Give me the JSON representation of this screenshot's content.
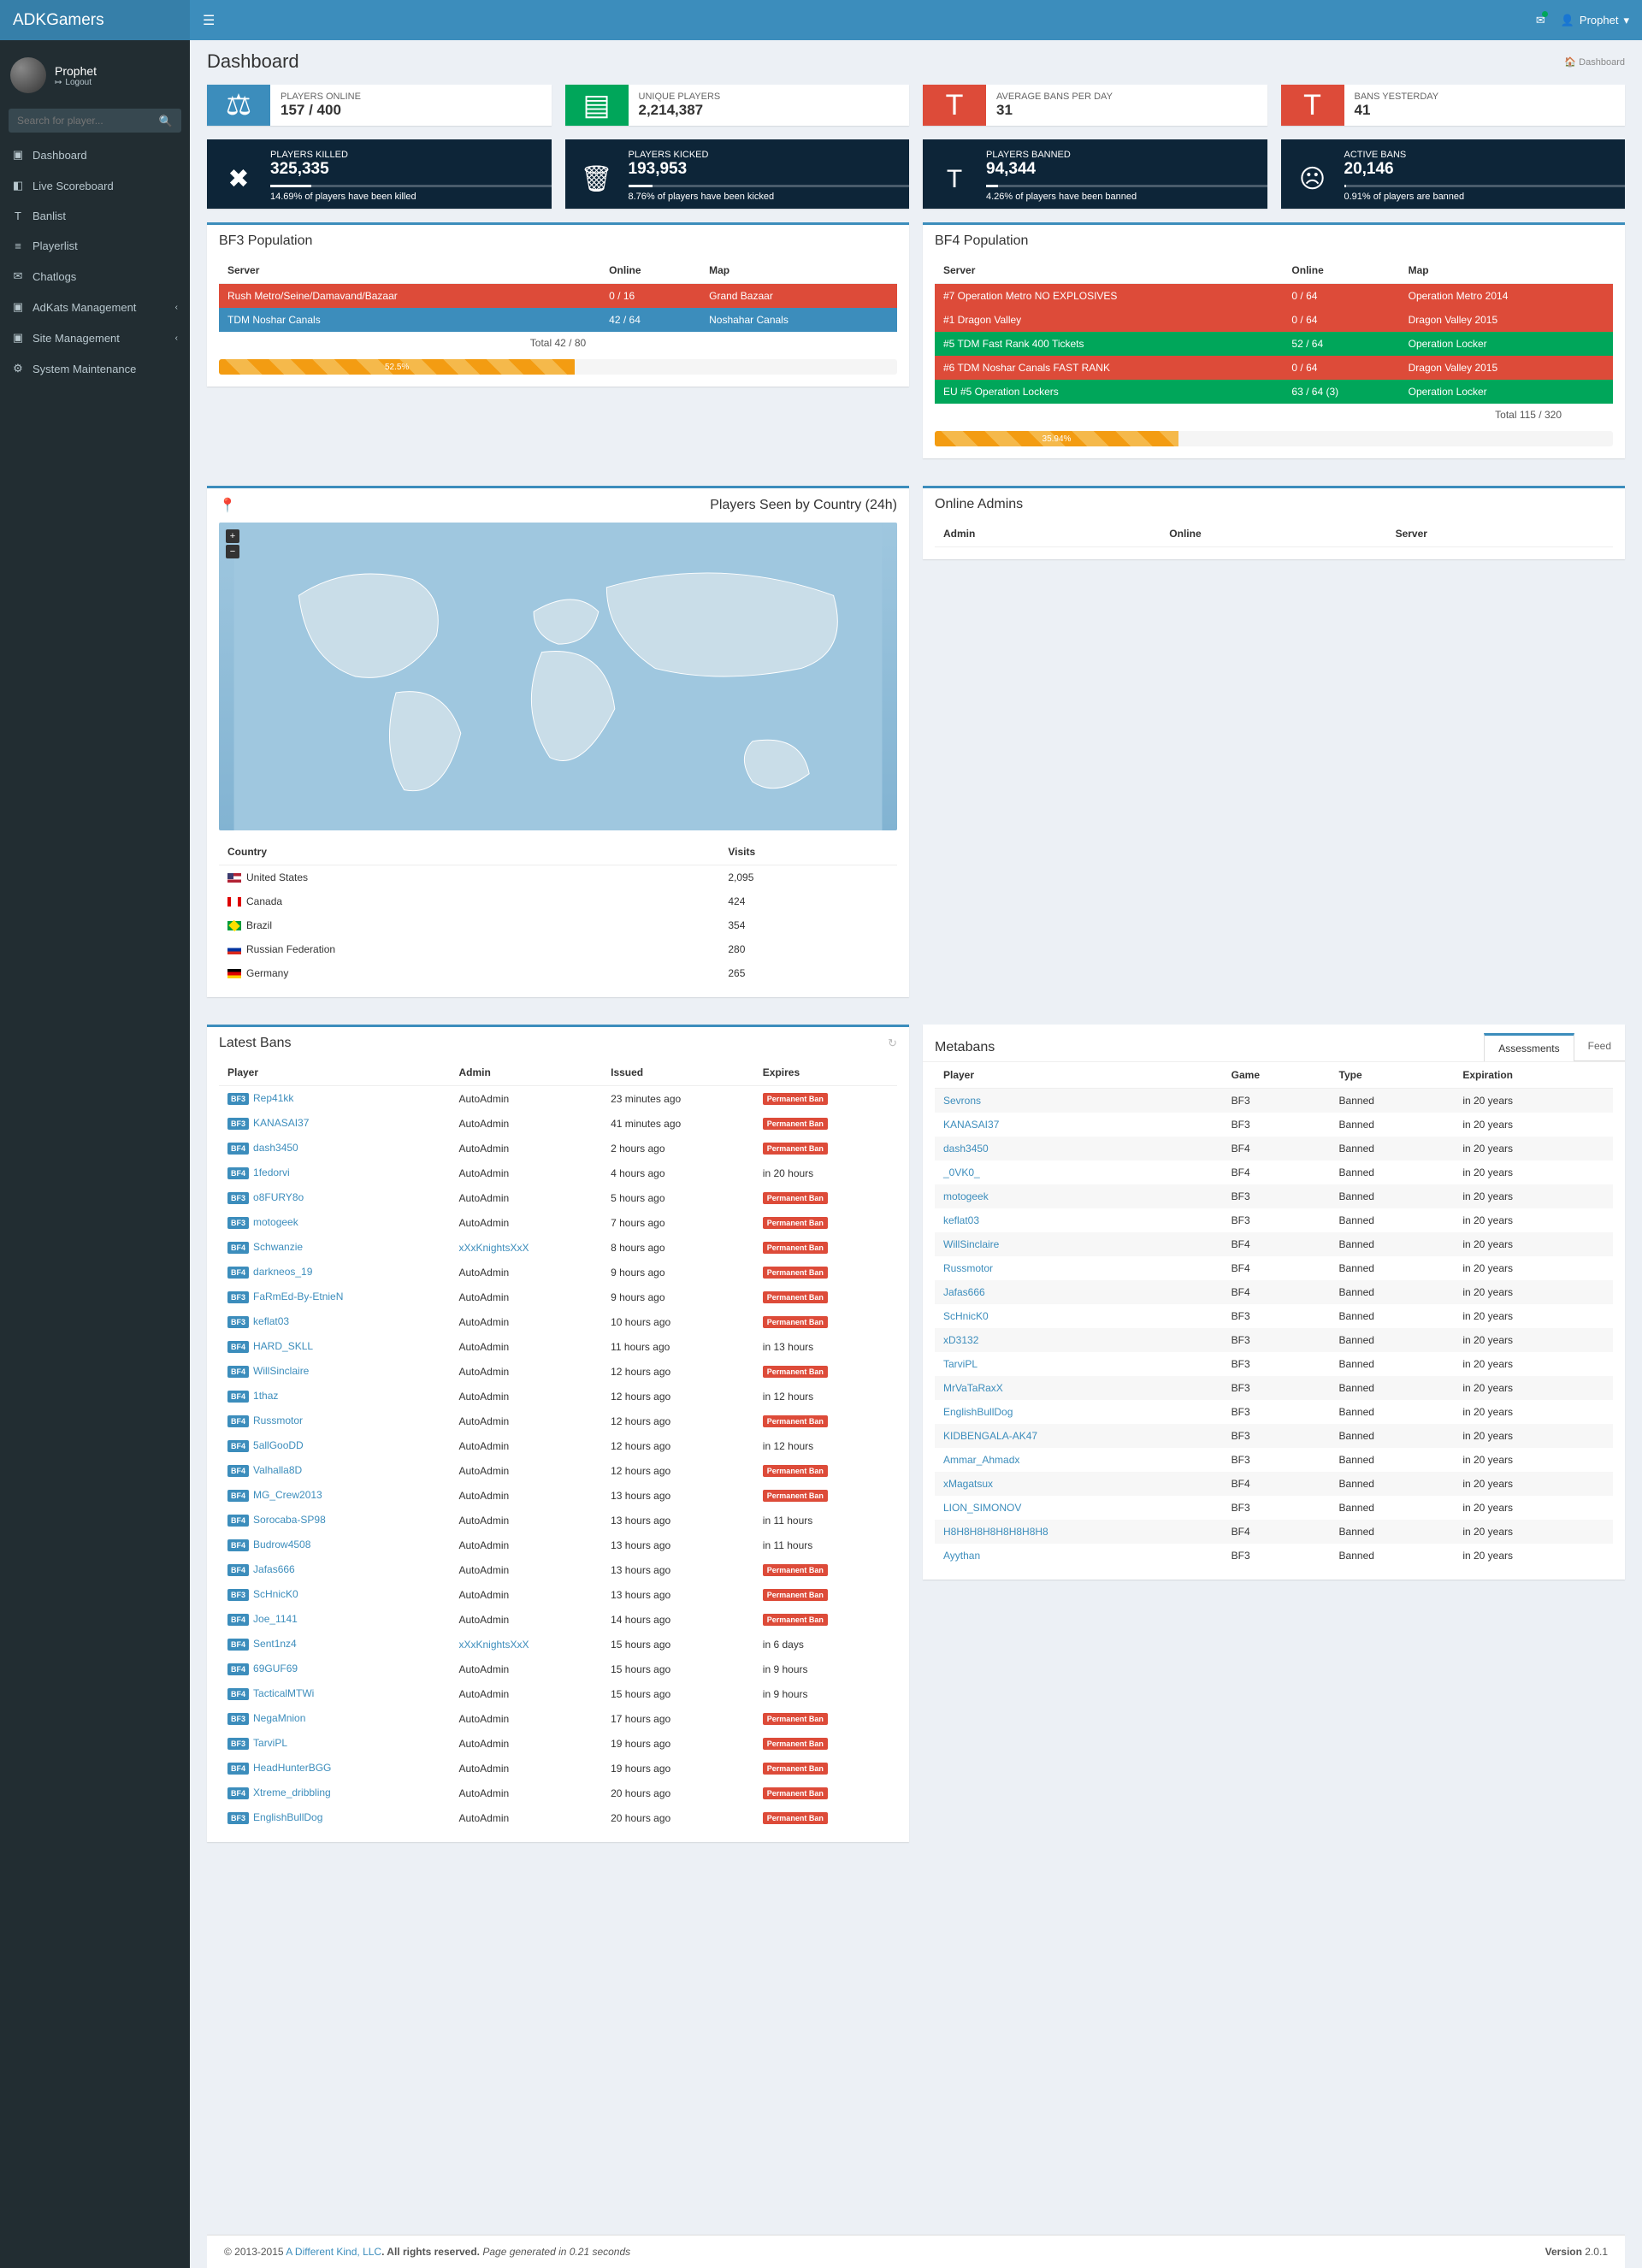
{
  "brand": "ADKGamers",
  "user": {
    "name": "Prophet",
    "logout": "Logout"
  },
  "search": {
    "placeholder": "Search for player..."
  },
  "nav": [
    {
      "icon": "▣",
      "label": "Dashboard"
    },
    {
      "icon": "◧",
      "label": "Live Scoreboard"
    },
    {
      "icon": "T",
      "label": "Banlist"
    },
    {
      "icon": "≡",
      "label": "Playerlist"
    },
    {
      "icon": "✉",
      "label": "Chatlogs"
    },
    {
      "icon": "▣",
      "label": "AdKats Management",
      "sub": true
    },
    {
      "icon": "▣",
      "label": "Site Management",
      "sub": true
    },
    {
      "icon": "⚙",
      "label": "System Maintenance"
    }
  ],
  "page_title": "Dashboard",
  "breadcrumb": "Dashboard",
  "stats_top": [
    {
      "label": "PLAYERS ONLINE",
      "value": "157 / 400",
      "color": "#3c8dbc",
      "icon": "⚖"
    },
    {
      "label": "UNIQUE PLAYERS",
      "value": "2,214,387",
      "color": "#00a65a",
      "icon": "▤"
    },
    {
      "label": "AVERAGE BANS PER DAY",
      "value": "31",
      "color": "#dd4b39",
      "icon": "T"
    },
    {
      "label": "BANS YESTERDAY",
      "value": "41",
      "color": "#dd4b39",
      "icon": "T"
    }
  ],
  "kpis": [
    {
      "label": "PLAYERS KILLED",
      "value": "325,335",
      "desc": "14.69% of players have been killed",
      "pct": 14.69,
      "icon": "✖"
    },
    {
      "label": "PLAYERS KICKED",
      "value": "193,953",
      "desc": "8.76% of players have been kicked",
      "pct": 8.76,
      "icon": "🗑"
    },
    {
      "label": "PLAYERS BANNED",
      "value": "94,344",
      "desc": "4.26% of players have been banned",
      "pct": 4.26,
      "icon": "T"
    },
    {
      "label": "ACTIVE BANS",
      "value": "20,146",
      "desc": "0.91% of players are banned",
      "pct": 0.91,
      "icon": "☹"
    }
  ],
  "bf3": {
    "title": "BF3 Population",
    "cols": [
      "Server",
      "Online",
      "Map"
    ],
    "rows": [
      {
        "cls": "srv-red",
        "server": "Rush Metro/Seine/Damavand/Bazaar",
        "online": "0 / 16",
        "map": "Grand Bazaar"
      },
      {
        "cls": "srv-blue",
        "server": "TDM Noshar Canals",
        "online": "42 / 64",
        "map": "Noshahar Canals"
      }
    ],
    "total": "Total   42 / 80",
    "progress": "52.5%",
    "progress_w": 52.5
  },
  "bf4": {
    "title": "BF4 Population",
    "cols": [
      "Server",
      "Online",
      "Map"
    ],
    "rows": [
      {
        "cls": "srv-red",
        "server": "#7 Operation Metro NO EXPLOSIVES",
        "online": "0 / 64",
        "map": "Operation Metro 2014"
      },
      {
        "cls": "srv-red",
        "server": "#1 Dragon Valley",
        "online": "0 / 64",
        "map": "Dragon Valley 2015"
      },
      {
        "cls": "srv-green",
        "server": "#5 TDM Fast Rank 400 Tickets",
        "online": "52 / 64",
        "map": "Operation Locker"
      },
      {
        "cls": "srv-red",
        "server": "#6 TDM Noshar Canals FAST RANK",
        "online": "0 / 64",
        "map": "Dragon Valley 2015"
      },
      {
        "cls": "srv-green",
        "server": "EU #5 Operation Lockers",
        "online": "63 / 64 (3)",
        "map": "Operation Locker"
      }
    ],
    "total": "Total   115 / 320",
    "progress": "35.94%",
    "progress_w": 35.94
  },
  "countries": {
    "title": "Players Seen by Country (24h)",
    "cols": [
      "Country",
      "Visits"
    ],
    "rows": [
      {
        "flag": "us",
        "name": "United States",
        "visits": "2,095"
      },
      {
        "flag": "ca",
        "name": "Canada",
        "visits": "424"
      },
      {
        "flag": "br",
        "name": "Brazil",
        "visits": "354"
      },
      {
        "flag": "ru",
        "name": "Russian Federation",
        "visits": "280"
      },
      {
        "flag": "de",
        "name": "Germany",
        "visits": "265"
      }
    ]
  },
  "online_admins": {
    "title": "Online Admins",
    "cols": [
      "Admin",
      "Online",
      "Server"
    ]
  },
  "latest_bans": {
    "title": "Latest Bans",
    "cols": [
      "Player",
      "Admin",
      "Issued",
      "Expires"
    ],
    "rows": [
      {
        "g": "BF3",
        "p": "Rep41kk",
        "a": "AutoAdmin",
        "i": "23 minutes ago",
        "e": "perm"
      },
      {
        "g": "BF3",
        "p": "KANASAI37",
        "a": "AutoAdmin",
        "i": "41 minutes ago",
        "e": "perm"
      },
      {
        "g": "BF4",
        "p": "dash3450",
        "a": "AutoAdmin",
        "i": "2 hours ago",
        "e": "perm"
      },
      {
        "g": "BF4",
        "p": "1fedorvi",
        "a": "AutoAdmin",
        "i": "4 hours ago",
        "e": "in 20 hours"
      },
      {
        "g": "BF3",
        "p": "o8FURY8o",
        "a": "AutoAdmin",
        "i": "5 hours ago",
        "e": "perm"
      },
      {
        "g": "BF3",
        "p": "motogeek",
        "a": "AutoAdmin",
        "i": "7 hours ago",
        "e": "perm"
      },
      {
        "g": "BF4",
        "p": "Schwanzie",
        "a": "xXxKnightsXxX",
        "al": true,
        "i": "8 hours ago",
        "e": "perm"
      },
      {
        "g": "BF4",
        "p": "darkneos_19",
        "a": "AutoAdmin",
        "i": "9 hours ago",
        "e": "perm"
      },
      {
        "g": "BF3",
        "p": "FaRmEd-By-EtnieN",
        "a": "AutoAdmin",
        "i": "9 hours ago",
        "e": "perm"
      },
      {
        "g": "BF3",
        "p": "keflat03",
        "a": "AutoAdmin",
        "i": "10 hours ago",
        "e": "perm"
      },
      {
        "g": "BF4",
        "p": "HARD_SKLL",
        "a": "AutoAdmin",
        "i": "11 hours ago",
        "e": "in 13 hours"
      },
      {
        "g": "BF4",
        "p": "WillSinclaire",
        "a": "AutoAdmin",
        "i": "12 hours ago",
        "e": "perm"
      },
      {
        "g": "BF4",
        "p": "1thaz",
        "a": "AutoAdmin",
        "i": "12 hours ago",
        "e": "in 12 hours"
      },
      {
        "g": "BF4",
        "p": "Russmotor",
        "a": "AutoAdmin",
        "i": "12 hours ago",
        "e": "perm"
      },
      {
        "g": "BF4",
        "p": "5allGooDD",
        "a": "AutoAdmin",
        "i": "12 hours ago",
        "e": "in 12 hours"
      },
      {
        "g": "BF4",
        "p": "Valhalla8D",
        "a": "AutoAdmin",
        "i": "12 hours ago",
        "e": "perm"
      },
      {
        "g": "BF4",
        "p": "MG_Crew2013",
        "a": "AutoAdmin",
        "i": "13 hours ago",
        "e": "perm"
      },
      {
        "g": "BF4",
        "p": "Sorocaba-SP98",
        "a": "AutoAdmin",
        "i": "13 hours ago",
        "e": "in 11 hours"
      },
      {
        "g": "BF4",
        "p": "Budrow4508",
        "a": "AutoAdmin",
        "i": "13 hours ago",
        "e": "in 11 hours"
      },
      {
        "g": "BF4",
        "p": "Jafas666",
        "a": "AutoAdmin",
        "i": "13 hours ago",
        "e": "perm"
      },
      {
        "g": "BF3",
        "p": "ScHnicK0",
        "a": "AutoAdmin",
        "i": "13 hours ago",
        "e": "perm"
      },
      {
        "g": "BF4",
        "p": "Joe_1141",
        "a": "AutoAdmin",
        "i": "14 hours ago",
        "e": "perm"
      },
      {
        "g": "BF4",
        "p": "Sent1nz4",
        "a": "xXxKnightsXxX",
        "al": true,
        "i": "15 hours ago",
        "e": "in 6 days"
      },
      {
        "g": "BF4",
        "p": "69GUF69",
        "a": "AutoAdmin",
        "i": "15 hours ago",
        "e": "in 9 hours"
      },
      {
        "g": "BF4",
        "p": "TacticalMTWi",
        "a": "AutoAdmin",
        "i": "15 hours ago",
        "e": "in 9 hours"
      },
      {
        "g": "BF3",
        "p": "NegaMnion",
        "a": "AutoAdmin",
        "i": "17 hours ago",
        "e": "perm"
      },
      {
        "g": "BF3",
        "p": "TarviPL",
        "a": "AutoAdmin",
        "i": "19 hours ago",
        "e": "perm"
      },
      {
        "g": "BF4",
        "p": "HeadHunterBGG",
        "a": "AutoAdmin",
        "i": "19 hours ago",
        "e": "perm"
      },
      {
        "g": "BF4",
        "p": "Xtreme_dribbling",
        "a": "AutoAdmin",
        "i": "20 hours ago",
        "e": "perm"
      },
      {
        "g": "BF3",
        "p": "EnglishBullDog",
        "a": "AutoAdmin",
        "i": "20 hours ago",
        "e": "perm"
      }
    ],
    "permban_label": "Permanent Ban"
  },
  "metabans": {
    "title": "Metabans",
    "tabs": [
      "Assessments",
      "Feed"
    ],
    "cols": [
      "Player",
      "Game",
      "Type",
      "Expiration"
    ],
    "rows": [
      {
        "p": "Sevrons",
        "g": "BF3",
        "t": "Banned",
        "e": "in 20 years"
      },
      {
        "p": "KANASAI37",
        "g": "BF3",
        "t": "Banned",
        "e": "in 20 years"
      },
      {
        "p": "dash3450",
        "g": "BF4",
        "t": "Banned",
        "e": "in 20 years"
      },
      {
        "p": "_0VK0_",
        "g": "BF4",
        "t": "Banned",
        "e": "in 20 years"
      },
      {
        "p": "motogeek",
        "g": "BF3",
        "t": "Banned",
        "e": "in 20 years"
      },
      {
        "p": "keflat03",
        "g": "BF3",
        "t": "Banned",
        "e": "in 20 years"
      },
      {
        "p": "WillSinclaire",
        "g": "BF4",
        "t": "Banned",
        "e": "in 20 years"
      },
      {
        "p": "Russmotor",
        "g": "BF4",
        "t": "Banned",
        "e": "in 20 years"
      },
      {
        "p": "Jafas666",
        "g": "BF4",
        "t": "Banned",
        "e": "in 20 years"
      },
      {
        "p": "ScHnicK0",
        "g": "BF3",
        "t": "Banned",
        "e": "in 20 years"
      },
      {
        "p": "xD3132",
        "g": "BF3",
        "t": "Banned",
        "e": "in 20 years"
      },
      {
        "p": "TarviPL",
        "g": "BF3",
        "t": "Banned",
        "e": "in 20 years"
      },
      {
        "p": "MrVaTaRaxX",
        "g": "BF3",
        "t": "Banned",
        "e": "in 20 years"
      },
      {
        "p": "EnglishBullDog",
        "g": "BF3",
        "t": "Banned",
        "e": "in 20 years"
      },
      {
        "p": "KIDBENGALA-AK47",
        "g": "BF3",
        "t": "Banned",
        "e": "in 20 years"
      },
      {
        "p": "Ammar_Ahmadx",
        "g": "BF3",
        "t": "Banned",
        "e": "in 20 years"
      },
      {
        "p": "xMagatsux",
        "g": "BF4",
        "t": "Banned",
        "e": "in 20 years"
      },
      {
        "p": "LION_SIMONOV",
        "g": "BF3",
        "t": "Banned",
        "e": "in 20 years"
      },
      {
        "p": "H8H8H8H8H8H8H8H8",
        "g": "BF4",
        "t": "Banned",
        "e": "in 20 years"
      },
      {
        "p": "Ayythan",
        "g": "BF3",
        "t": "Banned",
        "e": "in 20 years"
      }
    ]
  },
  "footer": {
    "left_pre": "© 2013-2015 ",
    "left_link": "A Different Kind, LLC",
    "left_post": ". All rights reserved. ",
    "left_ital": "Page generated in 0.21 seconds",
    "right_b": "Version",
    "right_v": " 2.0.1"
  }
}
